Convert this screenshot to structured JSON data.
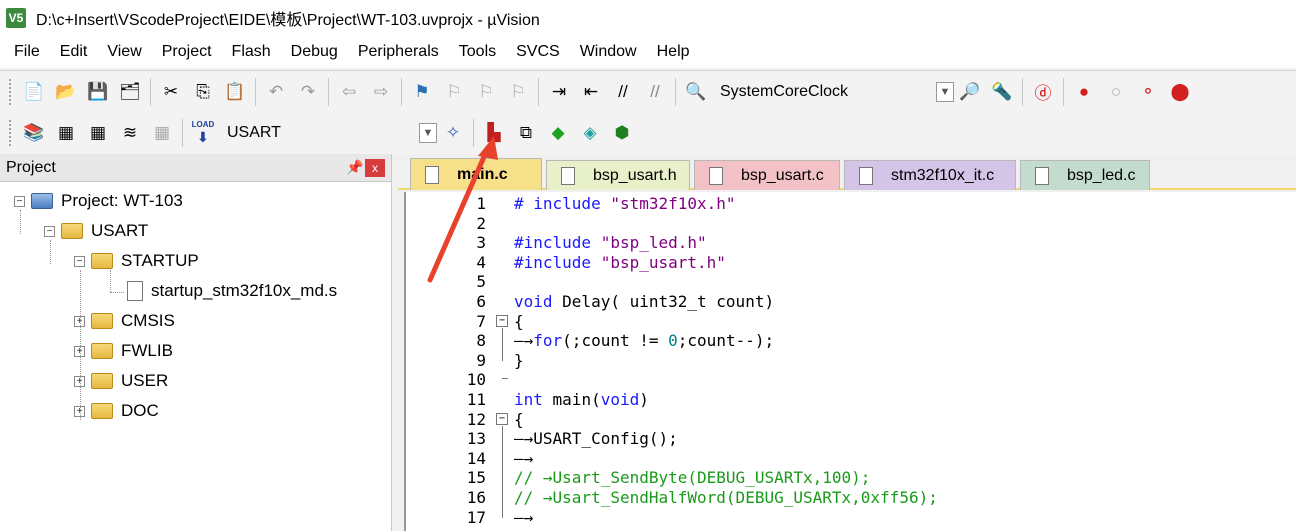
{
  "window": {
    "title": "D:\\c+Insert\\VScodeProject\\EIDE\\模板\\Project\\WT-103.uvprojx - µVision",
    "icon_label": "V5"
  },
  "menu": [
    "File",
    "Edit",
    "View",
    "Project",
    "Flash",
    "Debug",
    "Peripherals",
    "Tools",
    "SVCS",
    "Window",
    "Help"
  ],
  "toolbar1": {
    "combo_value": "SystemCoreClock"
  },
  "toolbar2": {
    "load_label": "LOAD",
    "target_value": "USART"
  },
  "project_panel": {
    "title": "Project",
    "pin": "ᵠ",
    "close": "x",
    "tree": [
      {
        "label": "Project: WT-103",
        "level": 0,
        "expander": "−"
      },
      {
        "label": "USART",
        "level": 1,
        "expander": "−"
      },
      {
        "label": "STARTUP",
        "level": 2,
        "expander": "−"
      },
      {
        "label": "startup_stm32f10x_md.s",
        "level": 3,
        "expander": ""
      },
      {
        "label": "CMSIS",
        "level": 2,
        "expander": "+"
      },
      {
        "label": "FWLIB",
        "level": 2,
        "expander": "+"
      },
      {
        "label": "USER",
        "level": 2,
        "expander": "+"
      },
      {
        "label": "DOC",
        "level": 2,
        "expander": "+"
      }
    ]
  },
  "tabs": [
    {
      "label": "main.c",
      "color": "#f7e08a",
      "active": true
    },
    {
      "label": "bsp_usart.h",
      "color": "#e7f0c8"
    },
    {
      "label": "bsp_usart.c",
      "color": "#f3c2c7"
    },
    {
      "label": "stm32f10x_it.c",
      "color": "#d3c4e8"
    },
    {
      "label": "bsp_led.c",
      "color": "#c4dccd"
    }
  ],
  "code": {
    "line_numbers": [
      "1",
      "2",
      "3",
      "4",
      "5",
      "6",
      "7",
      "8",
      "9",
      "10",
      "11",
      "12",
      "13",
      "14",
      "15",
      "16",
      "17"
    ],
    "lines": [
      [
        {
          "t": "# include ",
          "c": "kw"
        },
        {
          "t": "\"stm32f10x.h\"",
          "c": "str"
        }
      ],
      [],
      [
        {
          "t": "#include ",
          "c": "kw"
        },
        {
          "t": "\"bsp_led.h\"",
          "c": "str"
        }
      ],
      [
        {
          "t": "#include ",
          "c": "kw"
        },
        {
          "t": "\"bsp_usart.h\"",
          "c": "str"
        }
      ],
      [],
      [
        {
          "t": "void",
          "c": "kw"
        },
        {
          "t": " Delay( uint32_t count)",
          "c": ""
        }
      ],
      [
        {
          "t": "{",
          "c": ""
        }
      ],
      [
        {
          "t": "—→",
          "c": ""
        },
        {
          "t": "for",
          "c": "kw"
        },
        {
          "t": "(;count != ",
          "c": ""
        },
        {
          "t": "0",
          "c": "num"
        },
        {
          "t": ";count--);",
          "c": ""
        }
      ],
      [
        {
          "t": "}",
          "c": ""
        }
      ],
      [],
      [
        {
          "t": "int",
          "c": "kw"
        },
        {
          "t": " main(",
          "c": ""
        },
        {
          "t": "void",
          "c": "kw"
        },
        {
          "t": ")",
          "c": ""
        }
      ],
      [
        {
          "t": "{",
          "c": ""
        }
      ],
      [
        {
          "t": "—→USART_Config();",
          "c": ""
        }
      ],
      [
        {
          "t": "—→",
          "c": ""
        }
      ],
      [
        {
          "t": "// →Usart_SendByte(DEBUG_USARTx,100);",
          "c": "cmt"
        }
      ],
      [
        {
          "t": "// →Usart_SendHalfWord(DEBUG_USARTx,0xff56);",
          "c": "cmt"
        }
      ],
      [
        {
          "t": "—→",
          "c": ""
        }
      ]
    ],
    "fold_markers": {
      "7": "−",
      "12": "−"
    }
  },
  "colors": {
    "annotation_arrow": "#e8412c"
  }
}
